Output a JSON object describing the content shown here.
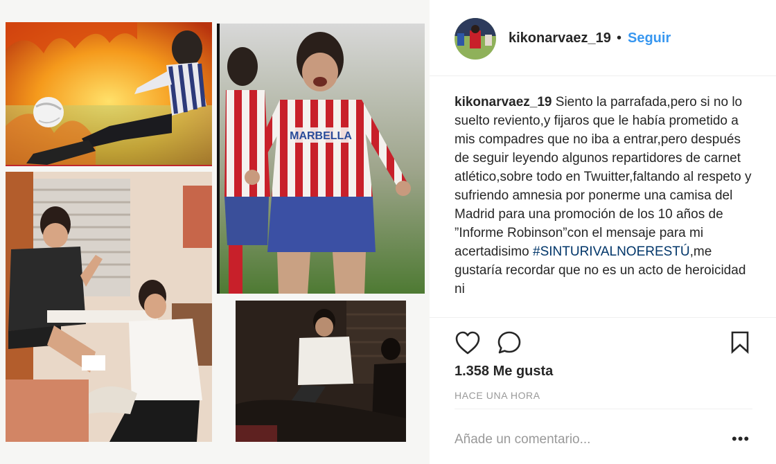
{
  "header": {
    "username": "kikonarvaez_19",
    "separator": "•",
    "follow_label": "Seguir"
  },
  "caption": {
    "username": "kikonarvaez_19",
    "text_before": "Siento la parrafada,pero si no lo suelto reviento,y fijaros que le había prometido a mis compadres que no iba a entrar,pero después de seguir leyendo algunos repartidores de carnet atlético,sobre todo en Twuitter,faltando al respeto y sufriendo amnesia por ponerme una camisa del Madrid para una promoción de los 10 años de ”Informe Robinson”con el mensaje para mi acertadisimo",
    "hashtag": "#SINTURIVALNOERESTÚ",
    "text_after": ",me gustaría recordar que no es un acto de heroicidad ni"
  },
  "actions": {
    "like_icon": "heart-outline-icon",
    "comment_icon": "comment-bubble-icon",
    "save_icon": "bookmark-icon",
    "likes": "1.358 Me gusta",
    "time_ago": "HACE UNA HORA"
  },
  "comment_box": {
    "placeholder": "Añade un comentario...",
    "more_label": "•••"
  },
  "media": {
    "photo_2_shirt_text": "MARBELLA"
  },
  "colors": {
    "link_blue": "#3897f0",
    "hashtag_blue": "#003569",
    "muted": "#999999",
    "atletico_red": "#c8202a"
  }
}
